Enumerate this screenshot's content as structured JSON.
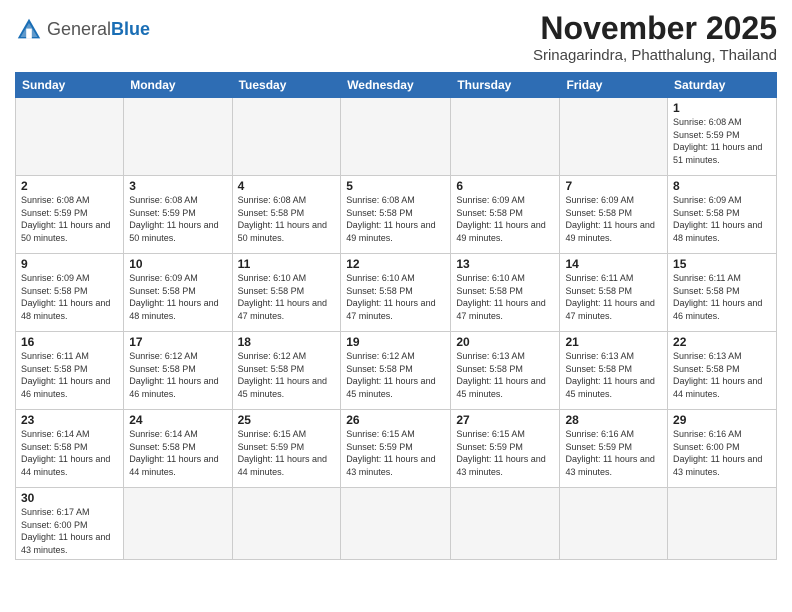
{
  "header": {
    "logo_general": "General",
    "logo_blue": "Blue",
    "title": "November 2025",
    "subtitle": "Srinagarindra, Phatthalung, Thailand"
  },
  "weekdays": [
    "Sunday",
    "Monday",
    "Tuesday",
    "Wednesday",
    "Thursday",
    "Friday",
    "Saturday"
  ],
  "weeks": [
    [
      {
        "day": "",
        "info": ""
      },
      {
        "day": "",
        "info": ""
      },
      {
        "day": "",
        "info": ""
      },
      {
        "day": "",
        "info": ""
      },
      {
        "day": "",
        "info": ""
      },
      {
        "day": "",
        "info": ""
      },
      {
        "day": "1",
        "info": "Sunrise: 6:08 AM\nSunset: 5:59 PM\nDaylight: 11 hours\nand 51 minutes."
      }
    ],
    [
      {
        "day": "2",
        "info": "Sunrise: 6:08 AM\nSunset: 5:59 PM\nDaylight: 11 hours\nand 50 minutes."
      },
      {
        "day": "3",
        "info": "Sunrise: 6:08 AM\nSunset: 5:59 PM\nDaylight: 11 hours\nand 50 minutes."
      },
      {
        "day": "4",
        "info": "Sunrise: 6:08 AM\nSunset: 5:58 PM\nDaylight: 11 hours\nand 50 minutes."
      },
      {
        "day": "5",
        "info": "Sunrise: 6:08 AM\nSunset: 5:58 PM\nDaylight: 11 hours\nand 49 minutes."
      },
      {
        "day": "6",
        "info": "Sunrise: 6:09 AM\nSunset: 5:58 PM\nDaylight: 11 hours\nand 49 minutes."
      },
      {
        "day": "7",
        "info": "Sunrise: 6:09 AM\nSunset: 5:58 PM\nDaylight: 11 hours\nand 49 minutes."
      },
      {
        "day": "8",
        "info": "Sunrise: 6:09 AM\nSunset: 5:58 PM\nDaylight: 11 hours\nand 48 minutes."
      }
    ],
    [
      {
        "day": "9",
        "info": "Sunrise: 6:09 AM\nSunset: 5:58 PM\nDaylight: 11 hours\nand 48 minutes."
      },
      {
        "day": "10",
        "info": "Sunrise: 6:09 AM\nSunset: 5:58 PM\nDaylight: 11 hours\nand 48 minutes."
      },
      {
        "day": "11",
        "info": "Sunrise: 6:10 AM\nSunset: 5:58 PM\nDaylight: 11 hours\nand 47 minutes."
      },
      {
        "day": "12",
        "info": "Sunrise: 6:10 AM\nSunset: 5:58 PM\nDaylight: 11 hours\nand 47 minutes."
      },
      {
        "day": "13",
        "info": "Sunrise: 6:10 AM\nSunset: 5:58 PM\nDaylight: 11 hours\nand 47 minutes."
      },
      {
        "day": "14",
        "info": "Sunrise: 6:11 AM\nSunset: 5:58 PM\nDaylight: 11 hours\nand 47 minutes."
      },
      {
        "day": "15",
        "info": "Sunrise: 6:11 AM\nSunset: 5:58 PM\nDaylight: 11 hours\nand 46 minutes."
      }
    ],
    [
      {
        "day": "16",
        "info": "Sunrise: 6:11 AM\nSunset: 5:58 PM\nDaylight: 11 hours\nand 46 minutes."
      },
      {
        "day": "17",
        "info": "Sunrise: 6:12 AM\nSunset: 5:58 PM\nDaylight: 11 hours\nand 46 minutes."
      },
      {
        "day": "18",
        "info": "Sunrise: 6:12 AM\nSunset: 5:58 PM\nDaylight: 11 hours\nand 45 minutes."
      },
      {
        "day": "19",
        "info": "Sunrise: 6:12 AM\nSunset: 5:58 PM\nDaylight: 11 hours\nand 45 minutes."
      },
      {
        "day": "20",
        "info": "Sunrise: 6:13 AM\nSunset: 5:58 PM\nDaylight: 11 hours\nand 45 minutes."
      },
      {
        "day": "21",
        "info": "Sunrise: 6:13 AM\nSunset: 5:58 PM\nDaylight: 11 hours\nand 45 minutes."
      },
      {
        "day": "22",
        "info": "Sunrise: 6:13 AM\nSunset: 5:58 PM\nDaylight: 11 hours\nand 44 minutes."
      }
    ],
    [
      {
        "day": "23",
        "info": "Sunrise: 6:14 AM\nSunset: 5:58 PM\nDaylight: 11 hours\nand 44 minutes."
      },
      {
        "day": "24",
        "info": "Sunrise: 6:14 AM\nSunset: 5:58 PM\nDaylight: 11 hours\nand 44 minutes."
      },
      {
        "day": "25",
        "info": "Sunrise: 6:15 AM\nSunset: 5:59 PM\nDaylight: 11 hours\nand 44 minutes."
      },
      {
        "day": "26",
        "info": "Sunrise: 6:15 AM\nSunset: 5:59 PM\nDaylight: 11 hours\nand 43 minutes."
      },
      {
        "day": "27",
        "info": "Sunrise: 6:15 AM\nSunset: 5:59 PM\nDaylight: 11 hours\nand 43 minutes."
      },
      {
        "day": "28",
        "info": "Sunrise: 6:16 AM\nSunset: 5:59 PM\nDaylight: 11 hours\nand 43 minutes."
      },
      {
        "day": "29",
        "info": "Sunrise: 6:16 AM\nSunset: 6:00 PM\nDaylight: 11 hours\nand 43 minutes."
      }
    ],
    [
      {
        "day": "30",
        "info": "Sunrise: 6:17 AM\nSunset: 6:00 PM\nDaylight: 11 hours\nand 43 minutes."
      },
      {
        "day": "",
        "info": ""
      },
      {
        "day": "",
        "info": ""
      },
      {
        "day": "",
        "info": ""
      },
      {
        "day": "",
        "info": ""
      },
      {
        "day": "",
        "info": ""
      },
      {
        "day": "",
        "info": ""
      }
    ]
  ]
}
